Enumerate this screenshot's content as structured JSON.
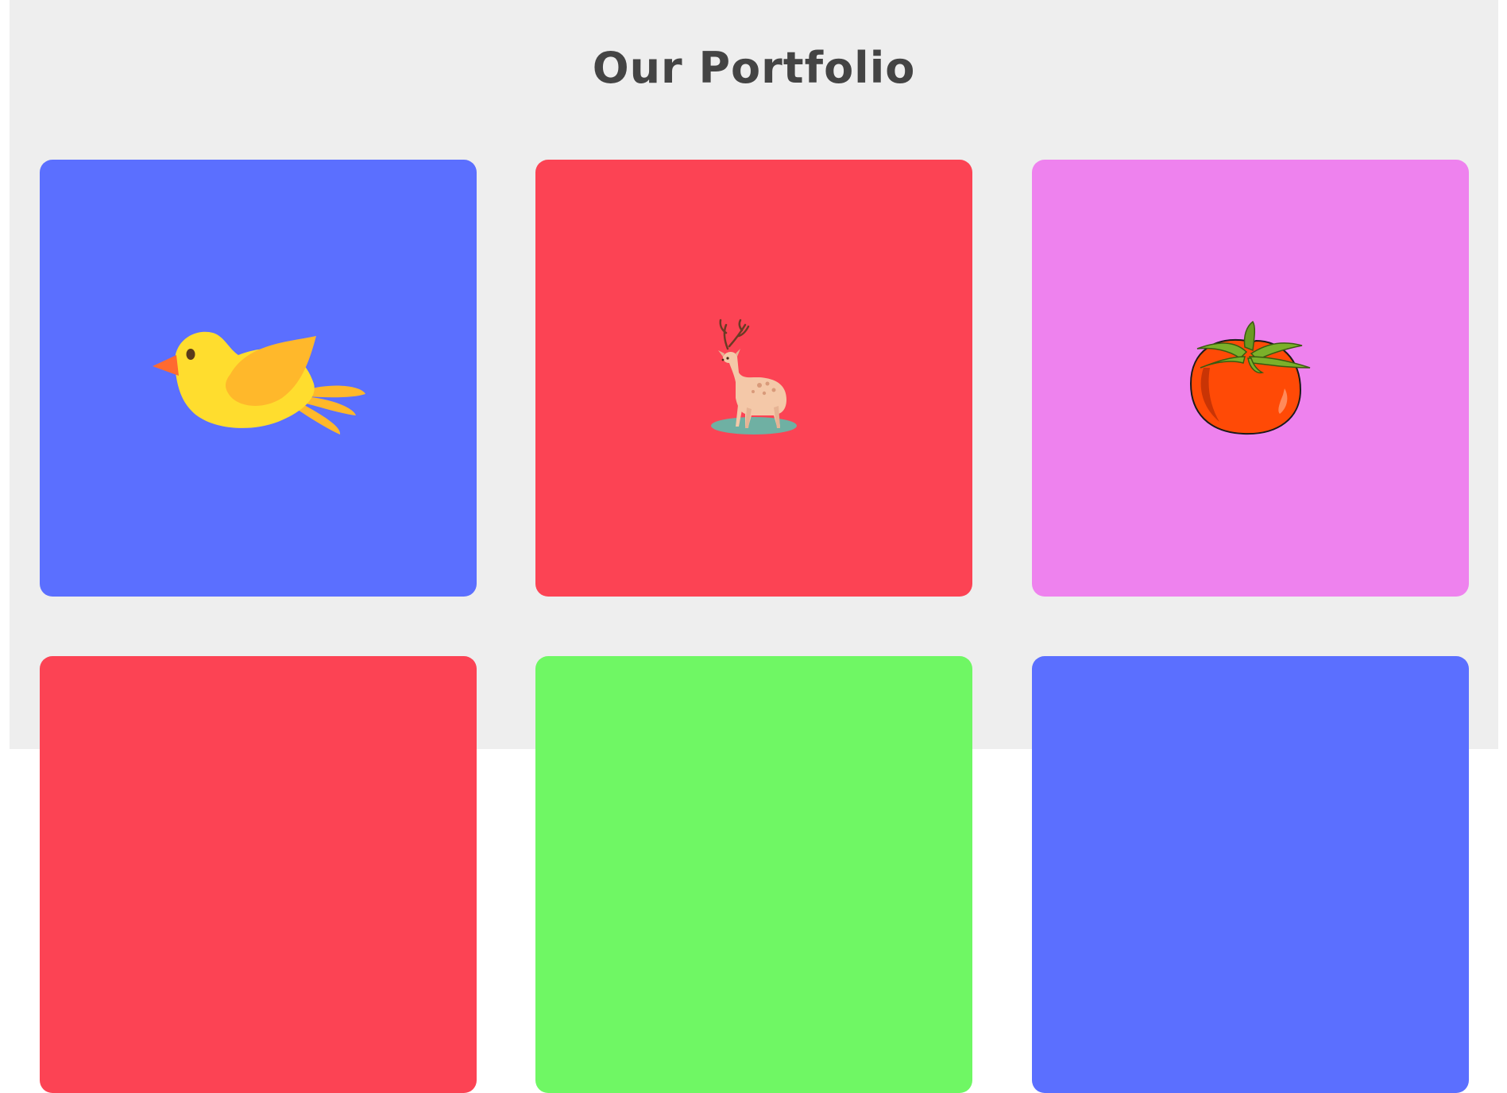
{
  "heading": {
    "title": "Our Portfolio"
  },
  "portfolio": {
    "items": [
      {
        "color": "#5b6fff",
        "icon": "bird-icon"
      },
      {
        "color": "#fc4354",
        "icon": "deer-icon"
      },
      {
        "color": "#ee82ee",
        "icon": "tomato-icon"
      },
      {
        "color": "#fc4354",
        "icon": ""
      },
      {
        "color": "#6ff764",
        "icon": ""
      },
      {
        "color": "#5b6fff",
        "icon": ""
      }
    ]
  }
}
